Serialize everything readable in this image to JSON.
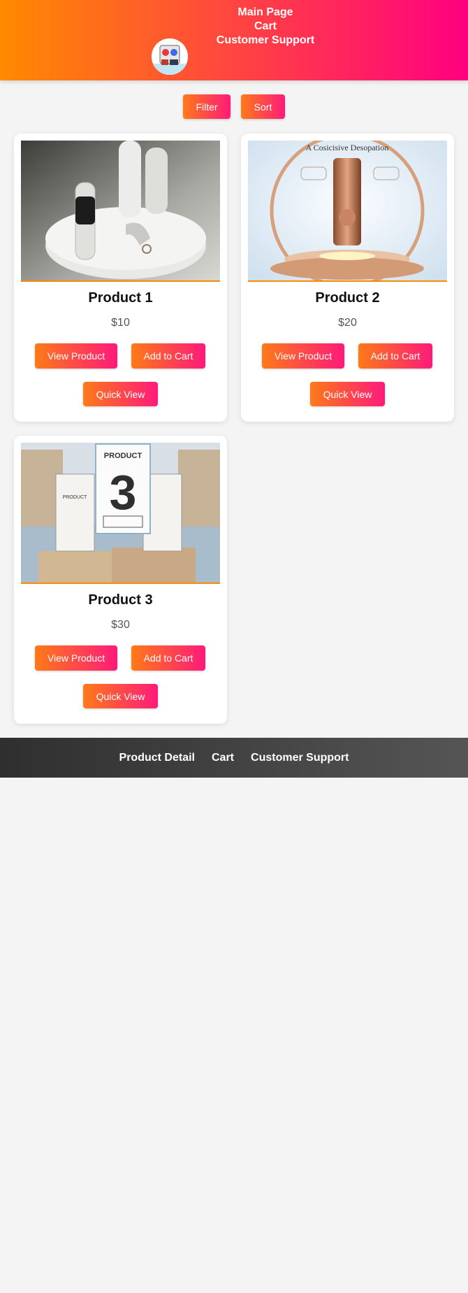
{
  "header": {
    "nav": [
      "Main Page",
      "Cart",
      "Customer Support"
    ]
  },
  "controls": {
    "filter_label": "Filter",
    "sort_label": "Sort"
  },
  "products": [
    {
      "name": "Product 1",
      "price": "$10",
      "image": "smartwatch-image"
    },
    {
      "name": "Product 2",
      "price": "$20",
      "image": "cosmetic-bottle-image"
    },
    {
      "name": "Product 3",
      "price": "$30",
      "image": "product-boxes-image"
    }
  ],
  "buttons": {
    "view_product": "View Product",
    "add_to_cart": "Add to Cart",
    "quick_view": "Quick View"
  },
  "image_text": {
    "product2_heading": "A Cosicisive Desopation",
    "product3_card_label": "PRODUCT",
    "product3_card_number": "3",
    "product3_box_label": "PRODUCT"
  },
  "footer": {
    "nav": [
      "Product Detail",
      "Cart",
      "Customer Support"
    ]
  },
  "colors": {
    "header_gradient_start": "#ff8a00",
    "header_gradient_end": "#ff0080",
    "button_gradient_start": "#ff7a18",
    "button_gradient_end": "#ff1a7a",
    "footer": "#333333",
    "page_background": "#f4f4f4"
  }
}
